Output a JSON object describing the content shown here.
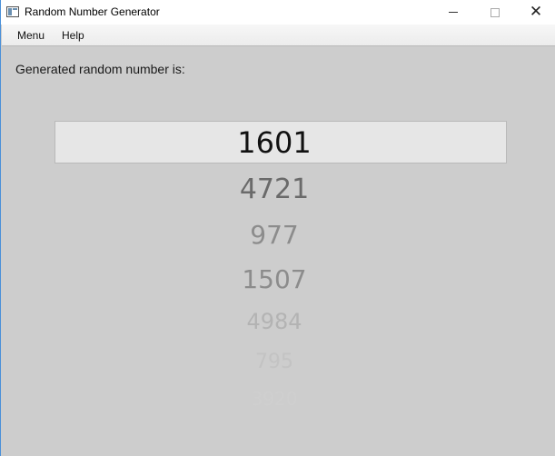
{
  "window": {
    "title": "Random Number Generator",
    "icon": "app-window-icon",
    "controls": {
      "minimize_icon": "minimize-icon",
      "maximize_icon": "maximize-icon",
      "close_glyph": "✕"
    }
  },
  "menubar": {
    "items": [
      {
        "label": "Menu"
      },
      {
        "label": "Help"
      }
    ]
  },
  "main": {
    "prompt": "Generated random number is:",
    "selected_number": "1601",
    "numbers": [
      "4721",
      "977",
      "1507",
      "4984",
      "795",
      "3920"
    ]
  },
  "colors": {
    "background": "#cdcdcd",
    "selected_box": "#e6e6e6",
    "titlebar": "#ffffff",
    "window_border": "#4a90d9"
  }
}
